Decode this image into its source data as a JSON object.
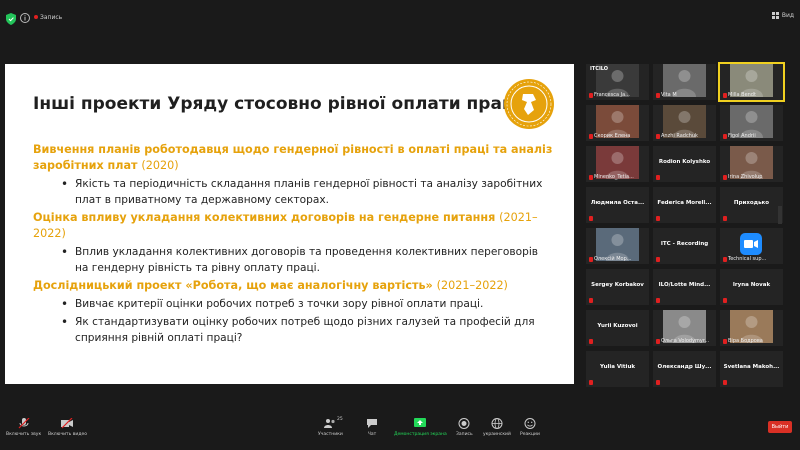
{
  "topbar": {
    "session_label": "Запись",
    "view_label": "Вид"
  },
  "slide": {
    "title": "Інші проекти Уряду стосовно рівної оплати праці",
    "sections": [
      {
        "heading": "Вивчення планів роботодавця щодо гендерної рівності в оплаті праці та аналіз заробітних плат",
        "year": "(2020)",
        "bullets": [
          "Якість та періодичність складання планів гендерної рівності та аналізу заробітних плат в приватному та державному секторах."
        ]
      },
      {
        "heading": "Оцінка впливу укладання колективних договорів на гендерне питання",
        "year": "(2021–2022)",
        "bullets": [
          "Вплив укладання колективних договорів та проведення колективних переговорів на гендерну рівність та рівну оплату праці."
        ]
      },
      {
        "heading": "Дослідницький проект «Робота, що має аналогічну вартість»",
        "year": "(2021–2022)",
        "bullets": [
          "Вивчає критерії оцінки робочих потреб з точки зору рівної оплати праці.",
          "Як стандартизувати оцінку робочих потреб щодо різних галузей та професій для сприяння рівній оплаті праці?"
        ]
      }
    ]
  },
  "participants": [
    {
      "name": "Francesca Ja...",
      "label": "",
      "logo": "ITCILO",
      "color": "#3a3a3a"
    },
    {
      "name": "Vita M",
      "label": "",
      "color": "#6a6a6a"
    },
    {
      "name": "Milla Bendt",
      "label": "",
      "color": "#8a8a7a",
      "active": true
    },
    {
      "name": "Скорик Елена",
      "label": "",
      "color": "#7b4b3a"
    },
    {
      "name": "Anzhi Radchuk",
      "label": "",
      "color": "#5a4a3a"
    },
    {
      "name": "Figol Andrii",
      "label": "",
      "color": "#6a6a6a"
    },
    {
      "name": "Minenko_Tetia...",
      "label": "",
      "color": "#7a3a3a"
    },
    {
      "name": "",
      "label": "Rodion Kolyshko"
    },
    {
      "name": "Irina Zhivolup",
      "label": "",
      "color": "#7a5a4a"
    },
    {
      "name": "",
      "label": "Людмила Оста..."
    },
    {
      "name": "",
      "label": "Federica Morell..."
    },
    {
      "name": "",
      "label": "Приходько"
    },
    {
      "name": "Олексій Мор...",
      "label": "",
      "color": "#5a6a7a"
    },
    {
      "name": "",
      "label": "ITC - Recording"
    },
    {
      "name": "Technical sup...",
      "label": "",
      "color": "#1e8cff",
      "zoom": true
    },
    {
      "name": "",
      "label": "Sergey Korbakov"
    },
    {
      "name": "",
      "label": "ILO/Lotte Mind..."
    },
    {
      "name": "",
      "label": "Iryna Novak"
    },
    {
      "name": "",
      "label": "Yurii Kuzovoi"
    },
    {
      "name": "Ольга Volodymyr...",
      "label": "",
      "color": "#8a8a8a"
    },
    {
      "name": "Віра Бодрова",
      "label": "",
      "color": "#9a7a5a"
    },
    {
      "name": "",
      "label": "Yulia Vitiuk"
    },
    {
      "name": "",
      "label": "Олександр Шу..."
    },
    {
      "name": "",
      "label": "Svetlana Makoh..."
    }
  ],
  "controls": {
    "unmute": "Включить звук",
    "video": "Включить видео",
    "participants": "Участники",
    "participants_count": "25",
    "chat": "Чат",
    "share": "Демонстрация экрана",
    "record": "Запись",
    "language": "украинский",
    "reactions": "Реакции",
    "leave": "Выйти"
  },
  "colors": {
    "accent": "#e6a20c",
    "share_green": "#23d959",
    "leave_red": "#d93025"
  }
}
